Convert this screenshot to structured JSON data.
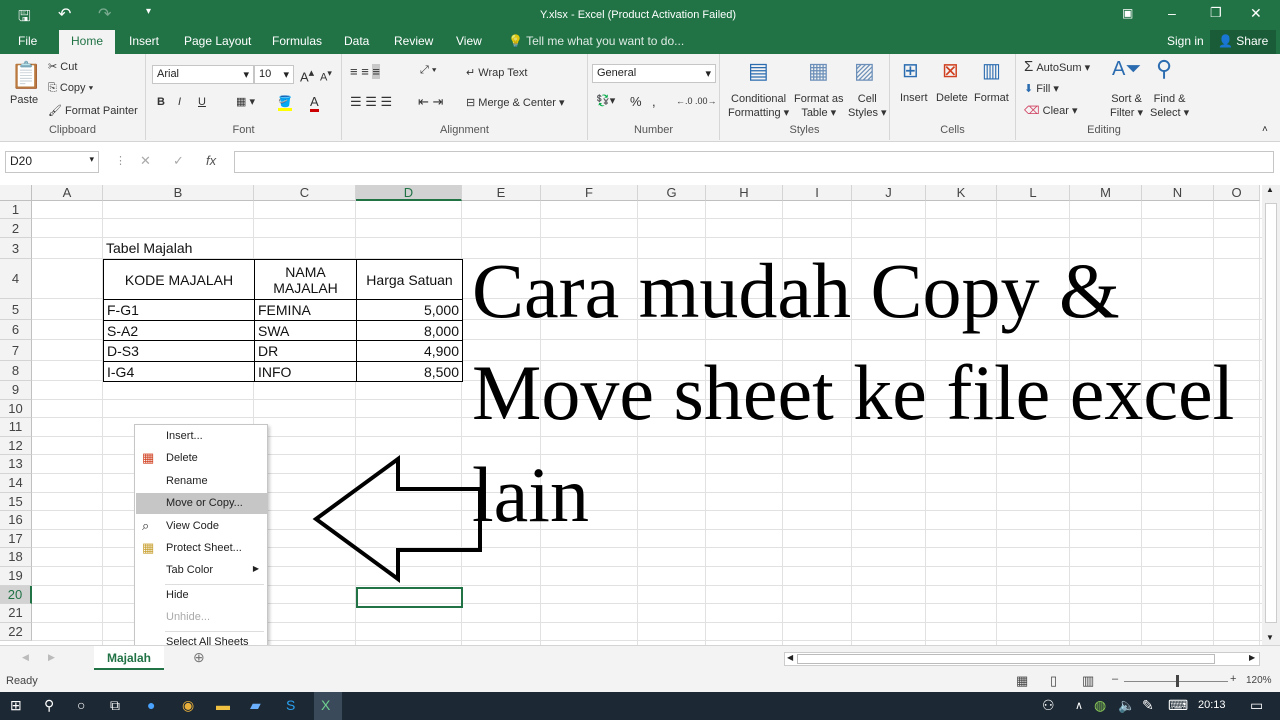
{
  "window": {
    "title": "Y.xlsx - Excel (Product Activation Failed)",
    "minimize": "–",
    "restore": "❐",
    "close": "✕"
  },
  "qat": {
    "save_icon": "save-icon",
    "undo_icon": "undo-icon",
    "redo_icon": "redo-icon"
  },
  "tabs": [
    "File",
    "Home",
    "Insert",
    "Page Layout",
    "Formulas",
    "Data",
    "Review",
    "View"
  ],
  "tell_me": "Tell me what you want to do...",
  "sign_in": "Sign in",
  "share": "Share",
  "ribbon": {
    "clipboard": {
      "label": "Clipboard",
      "paste": "Paste",
      "cut": "Cut",
      "copy": "Copy",
      "format_painter": "Format Painter"
    },
    "font": {
      "label": "Font",
      "font_name": "Arial",
      "font_size": "10",
      "bold": "B",
      "italic": "I",
      "underline": "U"
    },
    "alignment": {
      "label": "Alignment",
      "wrap_text": "Wrap Text",
      "merge_center": "Merge & Center"
    },
    "number": {
      "label": "Number",
      "format": "General",
      "percent": "%",
      "comma": ","
    },
    "styles": {
      "label": "Styles",
      "conditional": [
        "Conditional",
        "Formatting ▾"
      ],
      "format_table": [
        "Format as",
        "Table ▾"
      ],
      "cell_styles": [
        "Cell",
        "Styles ▾"
      ]
    },
    "cells": {
      "label": "Cells",
      "insert": "Insert",
      "delete": "Delete",
      "format": "Format"
    },
    "editing": {
      "label": "Editing",
      "autosum": "AutoSum",
      "fill": "Fill ▾",
      "clear": "Clear ▾",
      "sort": [
        "Sort &",
        "Filter ▾"
      ],
      "find": [
        "Find &",
        "Select ▾"
      ]
    }
  },
  "formula_bar": {
    "name_box": "D20",
    "formula": ""
  },
  "columns": [
    "A",
    "B",
    "C",
    "D",
    "E",
    "F",
    "G",
    "H",
    "I",
    "J",
    "K",
    "L",
    "M",
    "N",
    "O"
  ],
  "rows": [
    "1",
    "2",
    "3",
    "4",
    "5",
    "6",
    "7",
    "8",
    "9",
    "10",
    "11",
    "12",
    "13",
    "14",
    "15",
    "16",
    "17",
    "18",
    "19",
    "20",
    "21",
    "22"
  ],
  "sheet": {
    "table_title": "Tabel Majalah",
    "headers": [
      "KODE MAJALAH",
      "NAMA MAJALAH",
      "Harga Satuan"
    ],
    "rows": [
      [
        "F-G1",
        "FEMINA",
        "5,000"
      ],
      [
        "S-A2",
        "SWA",
        "8,000"
      ],
      [
        "D-S3",
        "DR",
        "4,900"
      ],
      [
        "I-G4",
        "INFO",
        "8,500"
      ]
    ],
    "overlay_text": "Cara mudah Copy & Move sheet ke file excel lain"
  },
  "context_menu": [
    {
      "label": "Insert...",
      "icon": ""
    },
    {
      "label": "Delete",
      "icon": "delete-sheet-icon"
    },
    {
      "label": "Rename",
      "icon": ""
    },
    {
      "label": "Move or Copy...",
      "icon": "",
      "highlighted": true
    },
    {
      "label": "View Code",
      "icon": "view-code-icon"
    },
    {
      "label": "Protect Sheet...",
      "icon": "protect-sheet-icon"
    },
    {
      "label": "Tab Color",
      "icon": "",
      "submenu": true
    },
    {
      "label": "Hide",
      "icon": ""
    },
    {
      "label": "Unhide...",
      "icon": "",
      "disabled": true
    },
    {
      "label": "Select All Sheets",
      "icon": ""
    }
  ],
  "sheet_tabs": [
    "Majalah"
  ],
  "status": {
    "text": "Ready",
    "zoom": "120%"
  },
  "taskbar": {
    "time": "20:13"
  },
  "colors": {
    "accent": "#217346",
    "selection": "#217346"
  }
}
